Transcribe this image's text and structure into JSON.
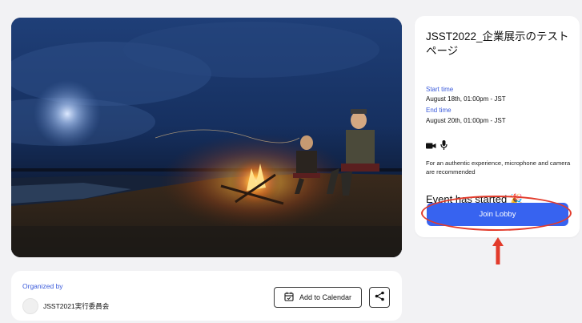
{
  "hero": {
    "alt": "Campfire on a beach at night"
  },
  "event": {
    "title": "JSST2022_企業展示のテストページ",
    "start_label": "Start time",
    "start_value": "August 18th, 01:00pm - JST",
    "end_label": "End time",
    "end_value": "August 20th, 01:00pm - JST",
    "notice": "For an authentic experience, microphone and camera are recommended",
    "status": "Event has started 🎉",
    "join_label": "Join Lobby"
  },
  "organizer": {
    "label": "Organized by",
    "name": "JSST2021実行委員会",
    "add_calendar_label": "Add to Calendar"
  },
  "icons": [
    "camera-icon",
    "microphone-icon",
    "calendar-icon",
    "share-icon",
    "arrow-up-icon"
  ],
  "colors": {
    "primary": "#3763f0",
    "annotation": "#e23b2b",
    "label": "#3b5bdb"
  }
}
